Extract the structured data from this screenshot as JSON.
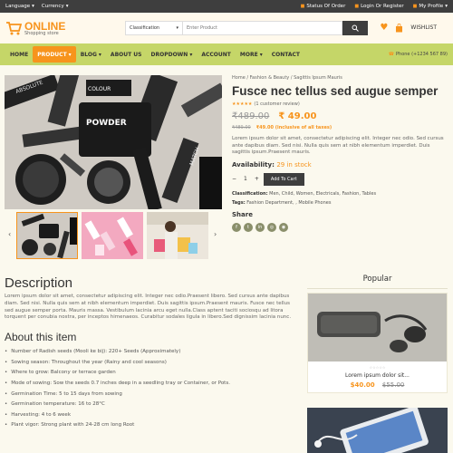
{
  "topbar": {
    "language": "Language",
    "currency": "Currency",
    "status": "Status Of Order",
    "login": "Login Or Register",
    "profile": "My Profile"
  },
  "header": {
    "logo_title": "ONLINE",
    "logo_sub": "Shopping store",
    "category": "Classification",
    "search_placeholder": "Enter Product",
    "wishlist": "WISHLIST"
  },
  "nav": {
    "items": [
      "HOME",
      "PRODUCT",
      "BLOG",
      "ABOUT US",
      "DROPDOWN",
      "ACCOUNT",
      "MORE",
      "CONTACT"
    ],
    "phone": "Phone (+1234 567 89)"
  },
  "product": {
    "breadcrumb": "Home / Fashion & Beauty / Sagittis Ipsum Mauris",
    "title": "Fusce nec tellus sed augue semper",
    "rating_text": "(1 customer review)",
    "stars": "★★★★★",
    "old_price": "₹489.00",
    "new_price": "₹ 49.00",
    "old_price_small": "₹489.00",
    "tax_price": "₹49.00 (inclusive of all taxes)",
    "description": "Lorem ipsum dolor sit amet, consectetur adipiscing elit. Integer nec odio. Sed cursus ante dapibus diam. Sed nisi. Nulla quis sem at nibh elementum imperdiet. Duis sagittis ipsum.Praesent mauris.",
    "availability_label": "Availability:",
    "availability_value": "29 in stock",
    "qty": "1",
    "minus": "−",
    "plus": "+",
    "add_to_cart": "Add To Cart",
    "classification_label": "Classification:",
    "classification_value": "Men, Child, Women, Electricals, Fashion, Tables",
    "tags_label": "Tags:",
    "tags_value": "Fashion Department, , Mobile Phones",
    "share": "Share",
    "socials": [
      "f",
      "t",
      "in",
      "◎",
      "◉"
    ]
  },
  "image_text": {
    "powder": "POWDER",
    "colour": "COLOUR",
    "absolute": "ABSOLUTE",
    "match": "MATCH"
  },
  "description": {
    "heading": "Description",
    "text": "Lorem ipsum dolor sit amet, consectetur adipiscing elit. Integer nec odio.Praesent libero. Sed cursus ante dapibus diam. Sed nisi. Nulla quis sem at nibh elementum imperdiet. Duis sagittis ipsum.Praesent mauris. Fusce nec tellus sed augue semper porta. Mauris massa. Vestibulum lacinia arcu eget nulla.Class aptent taciti sociosqu ad litora torquent per conubia nostra, per inceptos himenaeos. Curabitur sodales ligula in libero.Sed dignissim lacinia nunc.",
    "about_heading": "About this item",
    "bullets": [
      "Number of Radish seeds (Mooli ke bij): 220+ Seeds (Approximately)",
      "Sowing season: Throughout the year (Rainy and cool seasons)",
      "Where to grow: Balcony or terrace garden",
      "Mode of sowing: Sow the seeds 0.7 inches deep in a seedling tray or Container, or Pots.",
      "Germination Time: 5 to 15 days from sowing",
      "Germination temperature: 16 to 28°C",
      "Harvesting: 4 to 6 week",
      "Plant vigor: Strong plant with 24-28 cm long Root"
    ]
  },
  "popular": {
    "heading": "Popular",
    "stars": "☆☆☆☆☆",
    "name": "Lorem ipsum dolor sit...",
    "price": "$40.00",
    "old_price": "$55.00"
  },
  "colors": {
    "accent": "#f7941d",
    "nav_bg": "#c5d668",
    "dark": "#3e3e3e"
  }
}
